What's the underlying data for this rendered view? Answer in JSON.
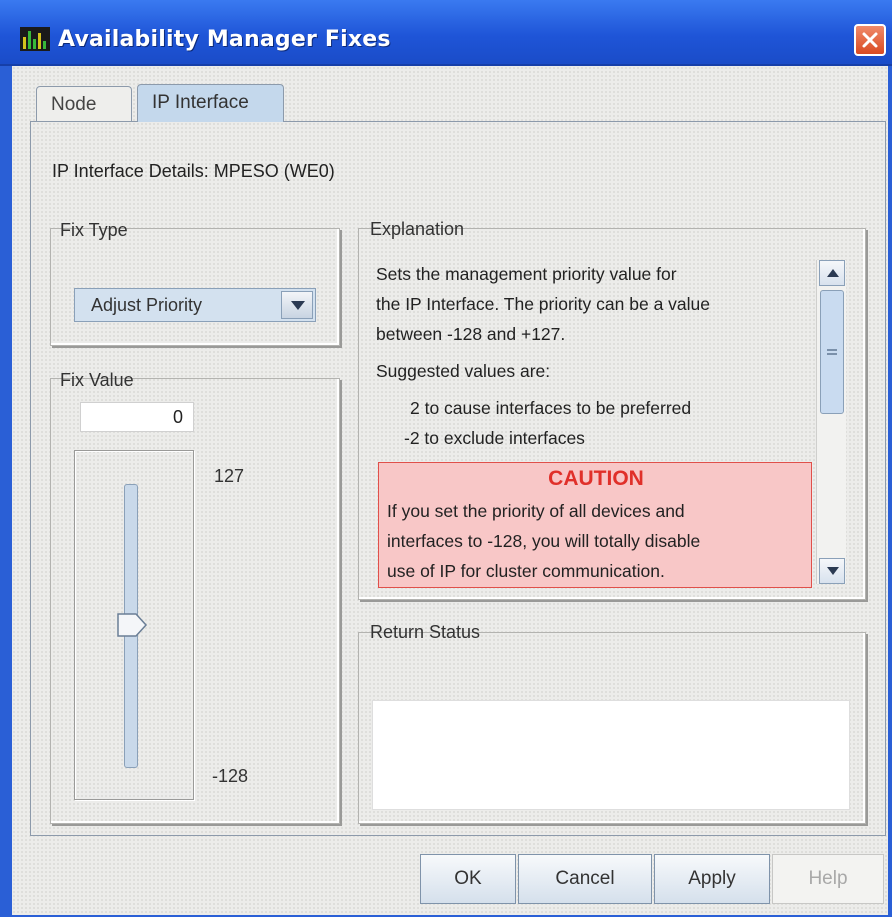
{
  "window": {
    "title": "Availability Manager Fixes"
  },
  "tabs": [
    {
      "label": "Node",
      "selected": false
    },
    {
      "label": "IP Interface",
      "selected": true
    }
  ],
  "details": {
    "text": "IP Interface Details: MPESO  (WE0)"
  },
  "fix_type": {
    "title": "Fix Type",
    "selected_value": "Adjust Priority"
  },
  "fix_value": {
    "title": "Fix Value",
    "value": "0",
    "slider": {
      "max_label": "127",
      "min_label": "-128",
      "current": 0,
      "min": -128,
      "max": 127
    }
  },
  "explanation": {
    "title": "Explanation",
    "lines": [
      "Sets the management priority value for",
      "the IP Interface. The priority can be a value",
      "between -128 and +127.",
      "Suggested values are:",
      "2 to cause interfaces to be preferred",
      "-2 to exclude interfaces"
    ],
    "caution": {
      "title": "CAUTION",
      "lines": [
        "If you set the priority of all devices and",
        "interfaces to -128, you will totally disable",
        "use of IP for cluster communication."
      ]
    }
  },
  "return_status": {
    "title": "Return Status",
    "text": ""
  },
  "buttons": {
    "ok": "OK",
    "cancel": "Cancel",
    "apply": "Apply",
    "help": "Help"
  },
  "colors": {
    "titlebar": "#1f55d8",
    "caution_bg": "#f8c7c7",
    "caution_text": "#e0302a",
    "selected_tab": "#c4d8ec"
  },
  "icons": {
    "app": "availability-manager-icon",
    "close": "close-icon",
    "dropdown": "chevron-down-icon",
    "scroll_up": "arrow-up-icon",
    "scroll_down": "arrow-down-icon",
    "slider_thumb": "slider-thumb"
  }
}
